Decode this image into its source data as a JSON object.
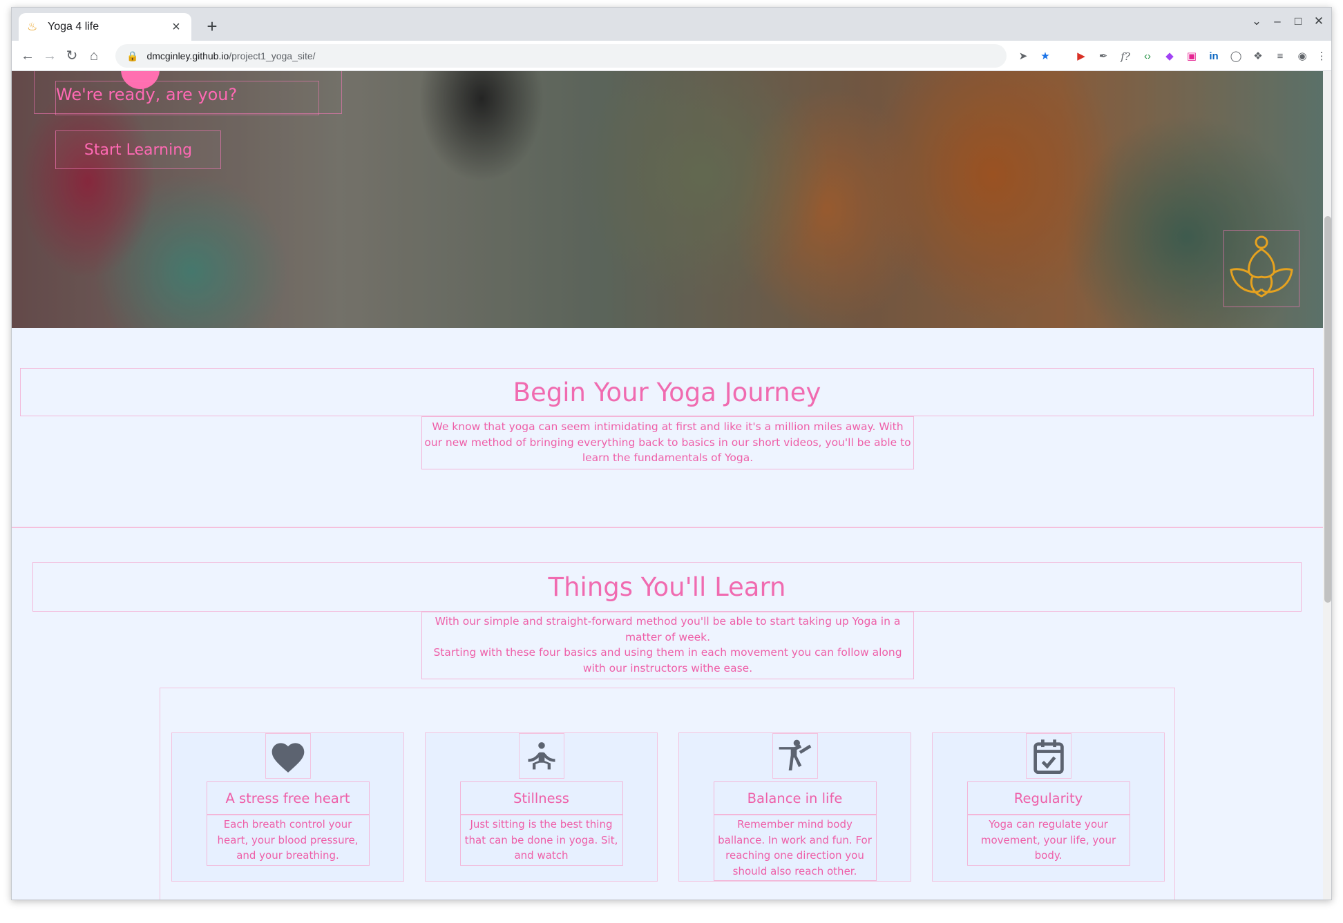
{
  "browser": {
    "tab_title": "Yoga 4 life",
    "tab_icon": "lotus-favicon-icon",
    "url_host": "dmcginley.github.io",
    "url_path": "/project1_yoga_site/"
  },
  "hero": {
    "tagline": "We're ready, are you?",
    "cta_label": "Start Learning",
    "logo_icon": "meditation-lotus-icon"
  },
  "journey": {
    "title": "Begin Your Yoga Journey",
    "text": "We know that yoga can seem intimidating at first and like it's a million miles away. With our new method of bringing everything back to basics in our short videos, you'll be able to learn the fundamentals of Yoga."
  },
  "learn": {
    "title": "Things You'll Learn",
    "text_line1": "With our simple and straight-forward method you'll be able to start taking up Yoga in a matter of week.",
    "text_line2": "Starting with these four basics and using them in each movement you can follow along with our instructors withe ease.",
    "cards": [
      {
        "icon": "heart-icon",
        "title": "A stress free heart",
        "text": "Each breath control your heart, your blood pressure, and your breathing."
      },
      {
        "icon": "meditation-icon",
        "title": "Stillness",
        "text": "Just sitting is the best thing that can be done in yoga. Sit, and watch"
      },
      {
        "icon": "kick-pose-icon",
        "title": "Balance in life",
        "text": "Remember mind body ballance. In work and fun. For reaching one direction you should also reach other."
      },
      {
        "icon": "calendar-check-icon",
        "title": "Regularity",
        "text": "Yoga can regulate your movement, your life, your body."
      }
    ]
  },
  "colors": {
    "accent_pink": "#f06bb0",
    "page_bg": "#eef4ff",
    "icon_gray": "#5c6370",
    "logo_gold": "#e6a21f"
  }
}
